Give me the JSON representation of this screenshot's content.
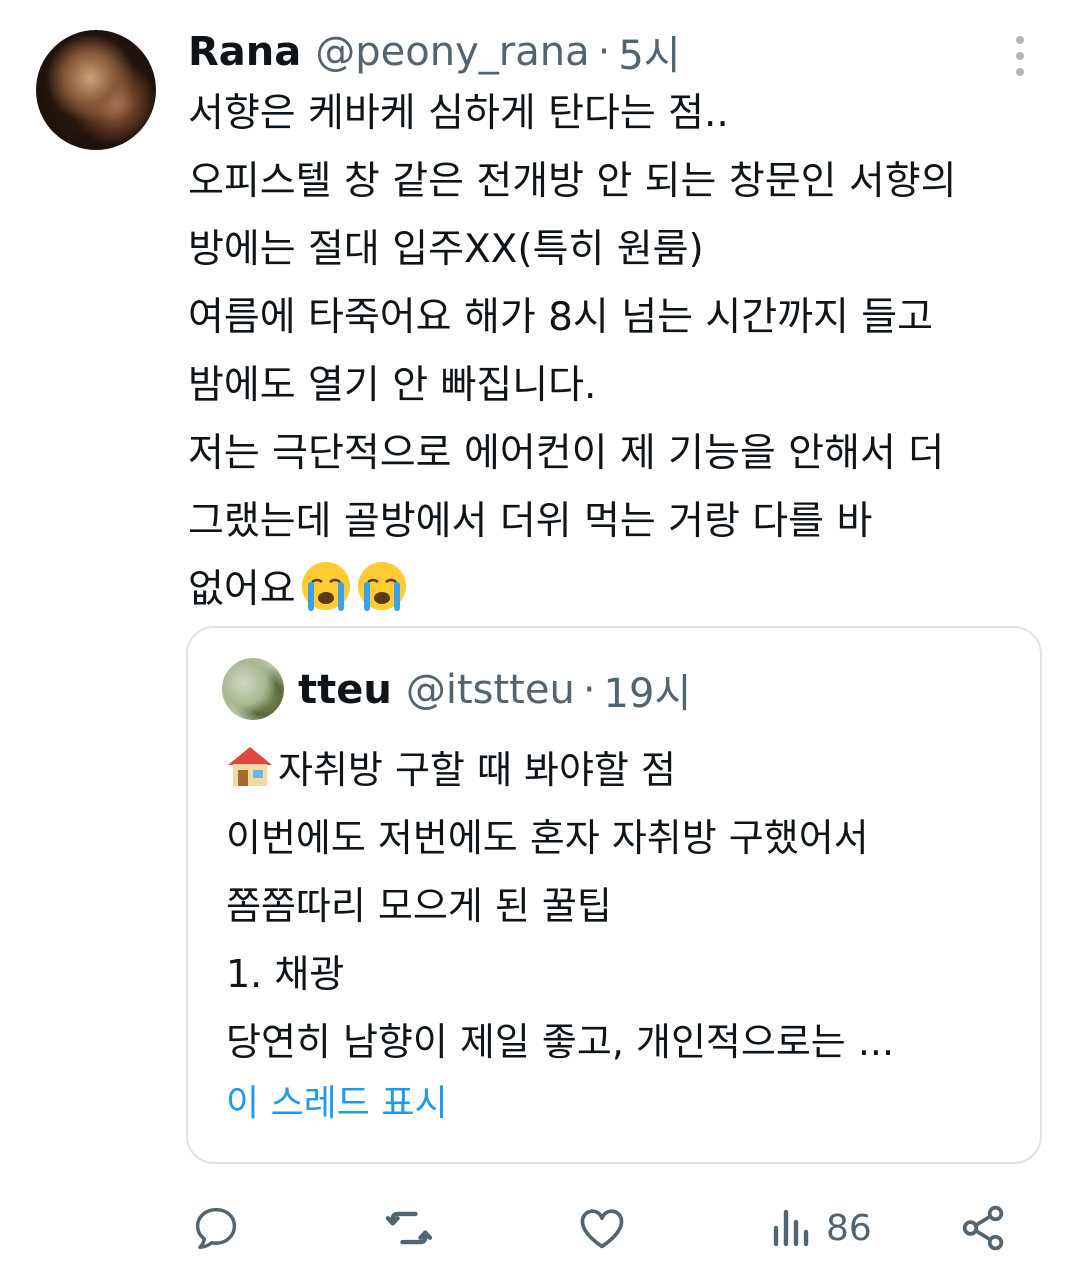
{
  "tweet": {
    "name": "Rana",
    "handle": "@peony_rana",
    "separator": "·",
    "time": "5시",
    "lines": [
      "서향은 케바케 심하게 탄다는 점..",
      "오피스텔 창 같은 전개방 안 되는 창문인 서향의",
      "방에는 절대 입주XX(특히 원룸)",
      "여름에 타죽어요 해가 8시 넘는 시간까지 들고",
      "밤에도 열기 안 빠집니다.",
      "저는 극단적으로 에어컨이 제 기능을 안해서 더",
      "그랬는데 골방에서 더위 먹는 거랑 다를 바",
      "없어요"
    ]
  },
  "quote": {
    "name": "tteu",
    "handle": "@itstteu",
    "separator": "·",
    "time": "19시",
    "lines": [
      "자취방 구할 때 봐야할 점",
      "이번에도 저번에도 혼자 자취방 구했어서",
      "쫌쫌따리 모으게 된 꿀팁",
      "1. 채광",
      "당연히 남향이 제일 좋고, 개인적으로는 ..."
    ],
    "show_thread": "이 스레드 표시"
  },
  "actions": {
    "views": "86"
  },
  "icons": {
    "reply": "reply-icon",
    "retweet": "retweet-icon",
    "like": "heart-icon",
    "views": "views-icon",
    "share": "share-icon",
    "more": "more-icon"
  },
  "colors": {
    "text": "#0f1419",
    "secondary": "#536471",
    "link": "#1d9bf0",
    "border": "#dfe3e6"
  }
}
